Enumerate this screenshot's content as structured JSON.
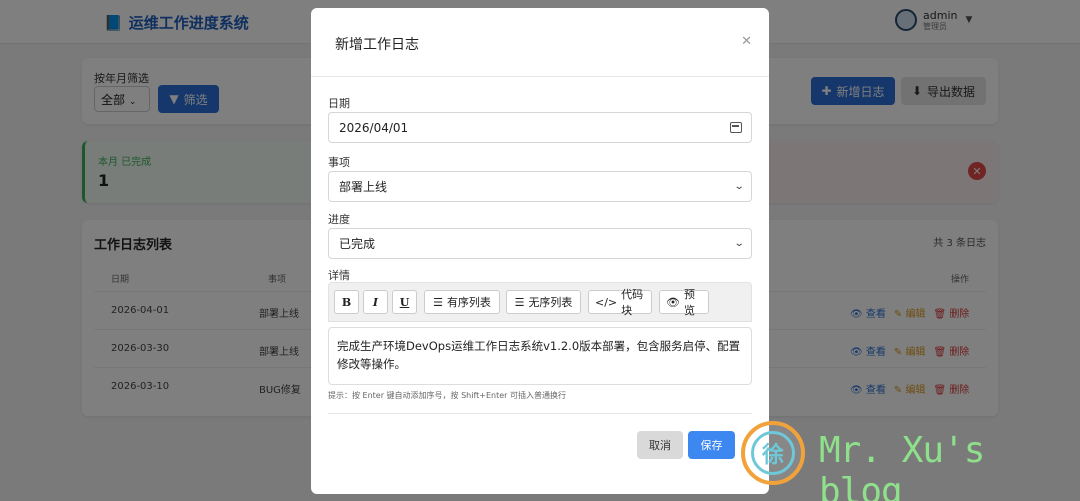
{
  "app": {
    "title": "运维工作进度系统"
  },
  "user": {
    "name": "admin",
    "role": "管理员"
  },
  "filter": {
    "label": "按年月筛选",
    "selected": "全部",
    "filter_button": "筛选",
    "add_button": "新增日志",
    "export_button": "导出数据"
  },
  "stats": {
    "done_label": "本月 已完成",
    "done_value": "1"
  },
  "list": {
    "title": "工作日志列表",
    "count_text": "共 3 条日志",
    "columns": {
      "date": "日期",
      "item": "事项",
      "actions": "操作"
    },
    "rows": [
      {
        "date": "2026-04-01",
        "item": "部署上线"
      },
      {
        "date": "2026-03-30",
        "item": "部署上线"
      },
      {
        "date": "2026-03-10",
        "item": "BUG修复"
      }
    ],
    "actions": {
      "view": "查看",
      "edit": "编辑",
      "delete": "删除"
    }
  },
  "modal": {
    "title": "新增工作日志",
    "date_label": "日期",
    "date_value": "2026/04/01",
    "item_label": "事项",
    "item_value": "部署上线",
    "progress_label": "进度",
    "progress_value": "已完成",
    "detail_label": "详情",
    "toolbar": {
      "bold": "B",
      "italic": "I",
      "underline": "U",
      "ordered_list": "有序列表",
      "unordered_list": "无序列表",
      "code_block": "代码块",
      "preview": "预览"
    },
    "editor_text": "完成生产环境DevOps运维工作日志系统v1.2.0版本部署，包含服务启停、配置修改等操作。",
    "hint": "提示：按 Enter 键自动添加序号，按 Shift+Enter 可插入普通换行",
    "cancel_button": "取消",
    "save_button": "保存"
  },
  "watermark": {
    "text": "Mr. Xu's blog",
    "glyph": "徐"
  }
}
